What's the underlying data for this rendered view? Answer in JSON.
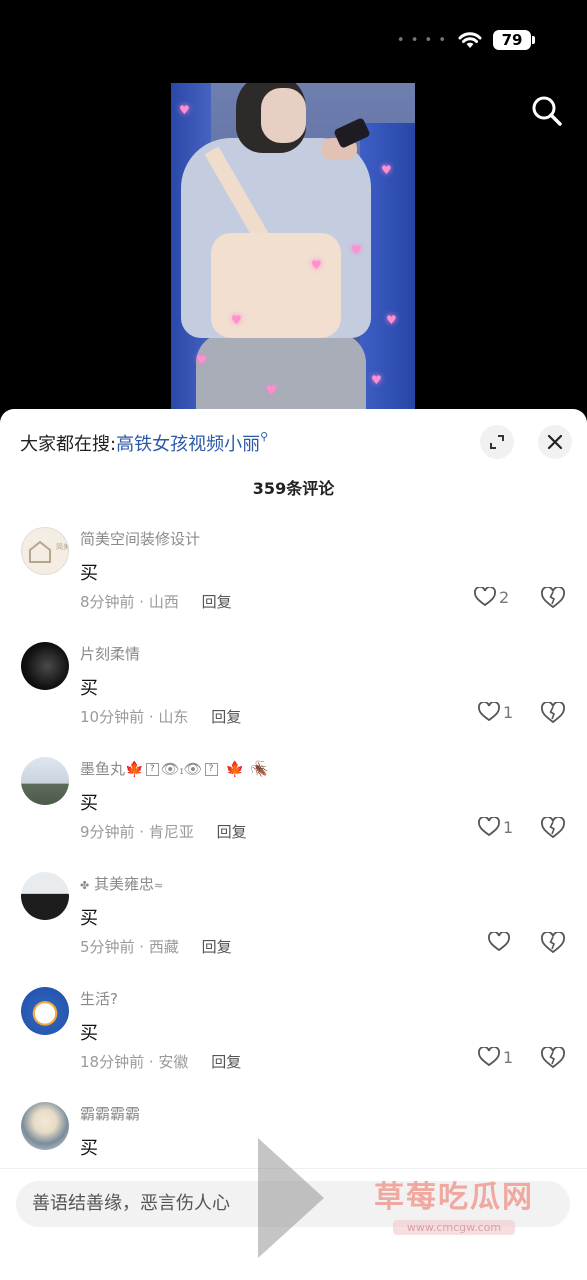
{
  "status_bar": {
    "battery": "79"
  },
  "hot_search": {
    "prefix": "大家都在搜:",
    "link": "高铁女孩视频小丽"
  },
  "comments_count": "359条评论",
  "comments": [
    {
      "name": "简美空间装修设计",
      "text": "买",
      "time_loc": "8分钟前 · 山西",
      "reply": "回复",
      "likes": "2",
      "avatar_text": "简美空间"
    },
    {
      "name": "片刻柔情",
      "text": "买",
      "time_loc": "10分钟前 · 山东",
      "reply": "回复",
      "likes": "1"
    },
    {
      "name": "墨鱼丸",
      "text": "买",
      "time_loc": "9分钟前 · 肯尼亚",
      "reply": "回复",
      "likes": "1"
    },
    {
      "name": "其美雍忠",
      "text": "买",
      "time_loc": "5分钟前 · 西藏",
      "reply": "回复",
      "likes": ""
    },
    {
      "name": "生活?",
      "text": "买",
      "time_loc": "18分钟前 · 安徽",
      "reply": "回复",
      "likes": "1"
    },
    {
      "name": "霸霸霸霸",
      "text": "买",
      "time_loc": "",
      "reply": "",
      "likes": ""
    }
  ],
  "input": {
    "placeholder": "善语结善缘，恶言伤人心"
  },
  "watermark": {
    "title": "草莓吃瓜网",
    "url": "www.cmcgw.com"
  },
  "colors": {
    "link": "#2d5aa8",
    "background": "#000000"
  }
}
